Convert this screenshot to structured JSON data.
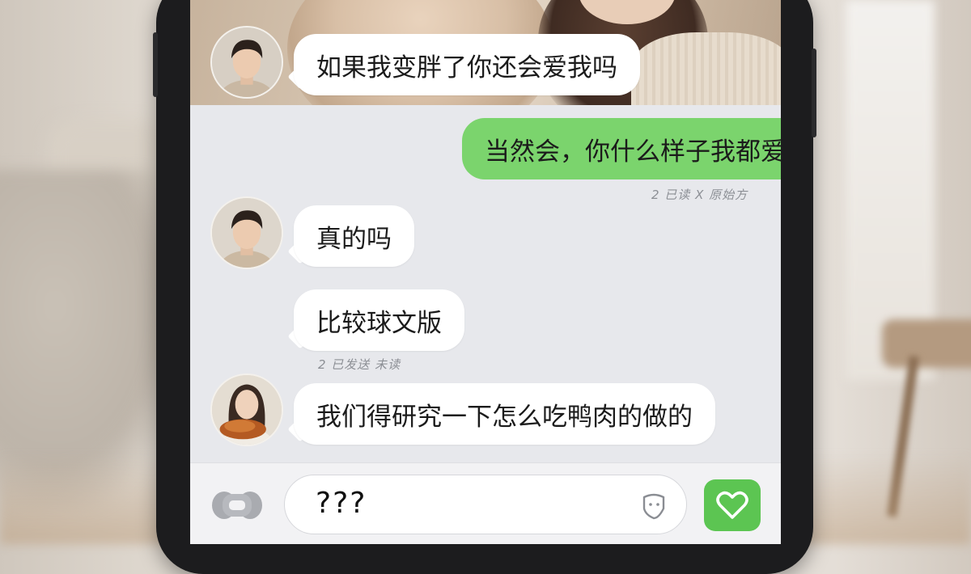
{
  "messages": [
    {
      "side": "in",
      "text": "如果我变胖了你还会爱我吗",
      "avatar": "man-avatar"
    },
    {
      "side": "out",
      "text": "当然会，你什么样子我都爱"
    },
    {
      "meta": "2 已读 X 原始方"
    },
    {
      "side": "in",
      "text": "真的吗",
      "avatar": "man-avatar"
    },
    {
      "side": "in",
      "text": "比较球文版"
    },
    {
      "meta": "2 已发送 未读"
    },
    {
      "side": "in",
      "text": "我们得研究一下怎么吃鸭肉的做的",
      "avatar": "woman-with-roast-duck-avatar"
    }
  ],
  "composer": {
    "value": "???",
    "voice_icon": "voice-toggle-icon",
    "emoji_icon": "sticker-icon",
    "send_icon": "heart-icon"
  },
  "colors": {
    "incoming_bubble": "#ffffff",
    "outgoing_bubble": "#7bd46d",
    "send_button": "#5cc552",
    "chat_background": "#e7e8ec"
  }
}
